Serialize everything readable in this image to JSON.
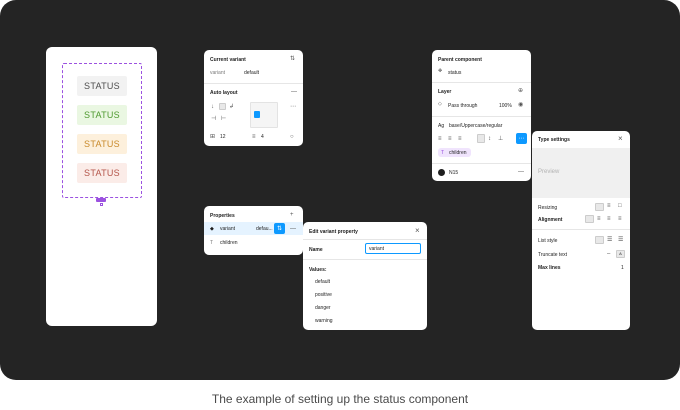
{
  "caption": "The example of setting up the status component",
  "statuses": [
    {
      "label": "STATUS",
      "bg": "#f2f2f2",
      "fg": "#4d4d4d"
    },
    {
      "label": "STATUS",
      "bg": "#eaf7e2",
      "fg": "#4f9a30"
    },
    {
      "label": "STATUS",
      "bg": "#fdf0dc",
      "fg": "#c98a2b"
    },
    {
      "label": "STATUS",
      "bg": "#fbece8",
      "fg": "#b4554a"
    }
  ],
  "current_variant": {
    "title": "Current variant",
    "prop_name": "variant",
    "prop_value": "default",
    "auto_layout_title": "Auto layout",
    "padding_h": "12",
    "gap": "4"
  },
  "properties": {
    "title": "Properties",
    "items": [
      {
        "icon": "◆",
        "name": "variant",
        "value": "defau..."
      },
      {
        "icon": "T",
        "name": "children",
        "value": ""
      }
    ]
  },
  "edit_variant": {
    "title": "Edit variant property",
    "name_label": "Name",
    "name_value": "variant",
    "values_label": "Values:",
    "values": [
      "default",
      "positive",
      "danger",
      "warning"
    ]
  },
  "parent_component": {
    "title": "Parent component",
    "component_name": "status",
    "layer_title": "Layer",
    "blend": "Pass through",
    "opacity": "100%",
    "text_style": "base/Uppercase/regular",
    "children_chip": "children",
    "fill_label": "N15"
  },
  "type_settings": {
    "title": "Type settings",
    "preview": "Preview",
    "resizing_label": "Resizing",
    "alignment_label": "Alignment",
    "list_style_label": "List style",
    "truncate_label": "Truncate text",
    "max_lines_label": "Max lines",
    "max_lines_value": "1"
  }
}
